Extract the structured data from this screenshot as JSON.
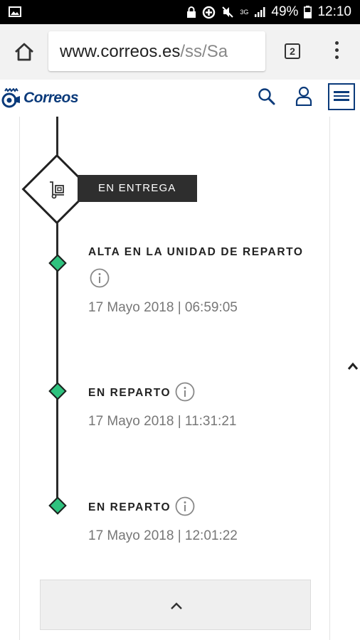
{
  "status_bar": {
    "network": "3G",
    "battery": "49%",
    "time": "12:10"
  },
  "browser": {
    "url_domain": "www.correos.es",
    "url_path": "/ss/Sa",
    "tab_count": "2"
  },
  "site": {
    "logo_text": "Correos"
  },
  "tracking": {
    "stage_label": "EN ENTREGA",
    "events": [
      {
        "title": "ALTA EN LA UNIDAD DE REPARTO",
        "date": "17 Mayo 2018 | 06:59:05"
      },
      {
        "title": "EN REPARTO",
        "date": "17 Mayo 2018 | 11:31:21"
      },
      {
        "title": "EN REPARTO",
        "date": "17 Mayo 2018 | 12:01:22"
      }
    ]
  },
  "colors": {
    "brand_blue": "#0a3a7a",
    "milestone_green": "#2ec27e",
    "label_bar": "#2e2e2e"
  },
  "icons": {
    "home": "home-icon",
    "tabs": "tabs-icon",
    "menu": "overflow-menu-icon",
    "search": "search-icon",
    "user": "user-icon",
    "hamburger": "hamburger-icon",
    "delivery": "hand-truck-icon",
    "info": "info-icon",
    "chevron": "chevron-up-icon"
  }
}
